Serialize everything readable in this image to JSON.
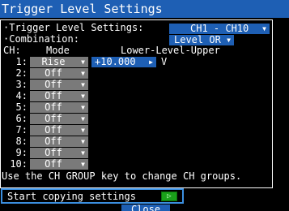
{
  "title": "Trigger Level Settings",
  "settings": {
    "trigger_label": "·Trigger Level Settings:",
    "trigger_value": "CH1 - CH10",
    "combination_label": "·Combination:",
    "combination_value": "Level OR"
  },
  "header": {
    "ch": "CH:",
    "mode": "Mode",
    "level": "Lower-Level-Upper"
  },
  "channels": [
    {
      "ch": "1:",
      "mode": "Rise",
      "level": "+10.000",
      "unit": "V"
    },
    {
      "ch": "2:",
      "mode": "Off"
    },
    {
      "ch": "3:",
      "mode": "Off"
    },
    {
      "ch": "4:",
      "mode": "Off"
    },
    {
      "ch": "5:",
      "mode": "Off"
    },
    {
      "ch": "6:",
      "mode": "Off"
    },
    {
      "ch": "7:",
      "mode": "Off"
    },
    {
      "ch": "8:",
      "mode": "Off"
    },
    {
      "ch": "9:",
      "mode": "Off"
    },
    {
      "ch": "10:",
      "mode": "Off"
    }
  ],
  "hint": "Use the CH GROUP key to change CH groups.",
  "copy": {
    "label": "Start copying settings",
    "button_glyph": "▷"
  },
  "close_label": "Close",
  "colors": {
    "title_bg": "#1e5fb4",
    "select_bg": "#7a7a7a",
    "copy_button": "#1aa01a",
    "focus_border": "#3b8fe0"
  }
}
